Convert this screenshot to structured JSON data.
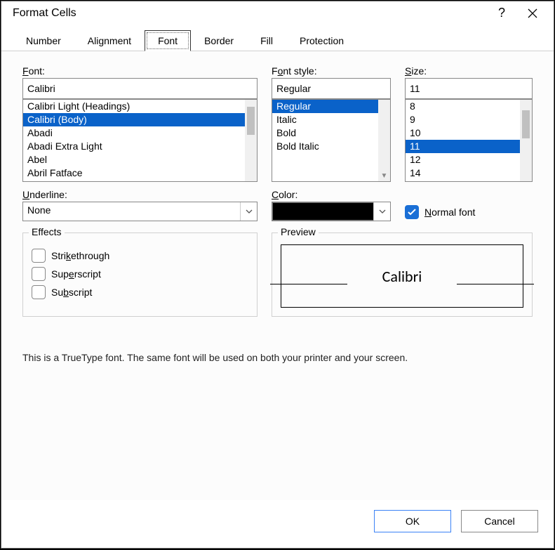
{
  "window": {
    "title": "Format Cells"
  },
  "tabs": {
    "items": [
      "Number",
      "Alignment",
      "Font",
      "Border",
      "Fill",
      "Protection"
    ],
    "active_index": 2
  },
  "font": {
    "label": "Font:",
    "value": "Calibri",
    "items": [
      "Calibri Light (Headings)",
      "Calibri (Body)",
      "Abadi",
      "Abadi Extra Light",
      "Abel",
      "Abril Fatface"
    ],
    "selected_index": 1
  },
  "font_style": {
    "label": "Font style:",
    "value": "Regular",
    "items": [
      "Regular",
      "Italic",
      "Bold",
      "Bold Italic"
    ],
    "selected_index": 0
  },
  "size": {
    "label": "Size:",
    "value": "11",
    "items": [
      "8",
      "9",
      "10",
      "11",
      "12",
      "14"
    ],
    "selected_index": 3
  },
  "underline": {
    "label": "Underline:",
    "value": "None"
  },
  "color": {
    "label": "Color:",
    "value": "#000000"
  },
  "normal_font": {
    "label": "Normal font",
    "checked": true
  },
  "effects": {
    "label": "Effects",
    "strikethrough": {
      "label": "Strikethrough",
      "checked": false
    },
    "superscript": {
      "label": "Superscript",
      "checked": false
    },
    "subscript": {
      "label": "Subscript",
      "checked": false
    }
  },
  "preview": {
    "label": "Preview",
    "text": "Calibri"
  },
  "footnote": "This is a TrueType font.  The same font will be used on both your printer and your screen.",
  "buttons": {
    "ok": "OK",
    "cancel": "Cancel"
  },
  "icons": {
    "help": "?",
    "caret": "▾"
  }
}
